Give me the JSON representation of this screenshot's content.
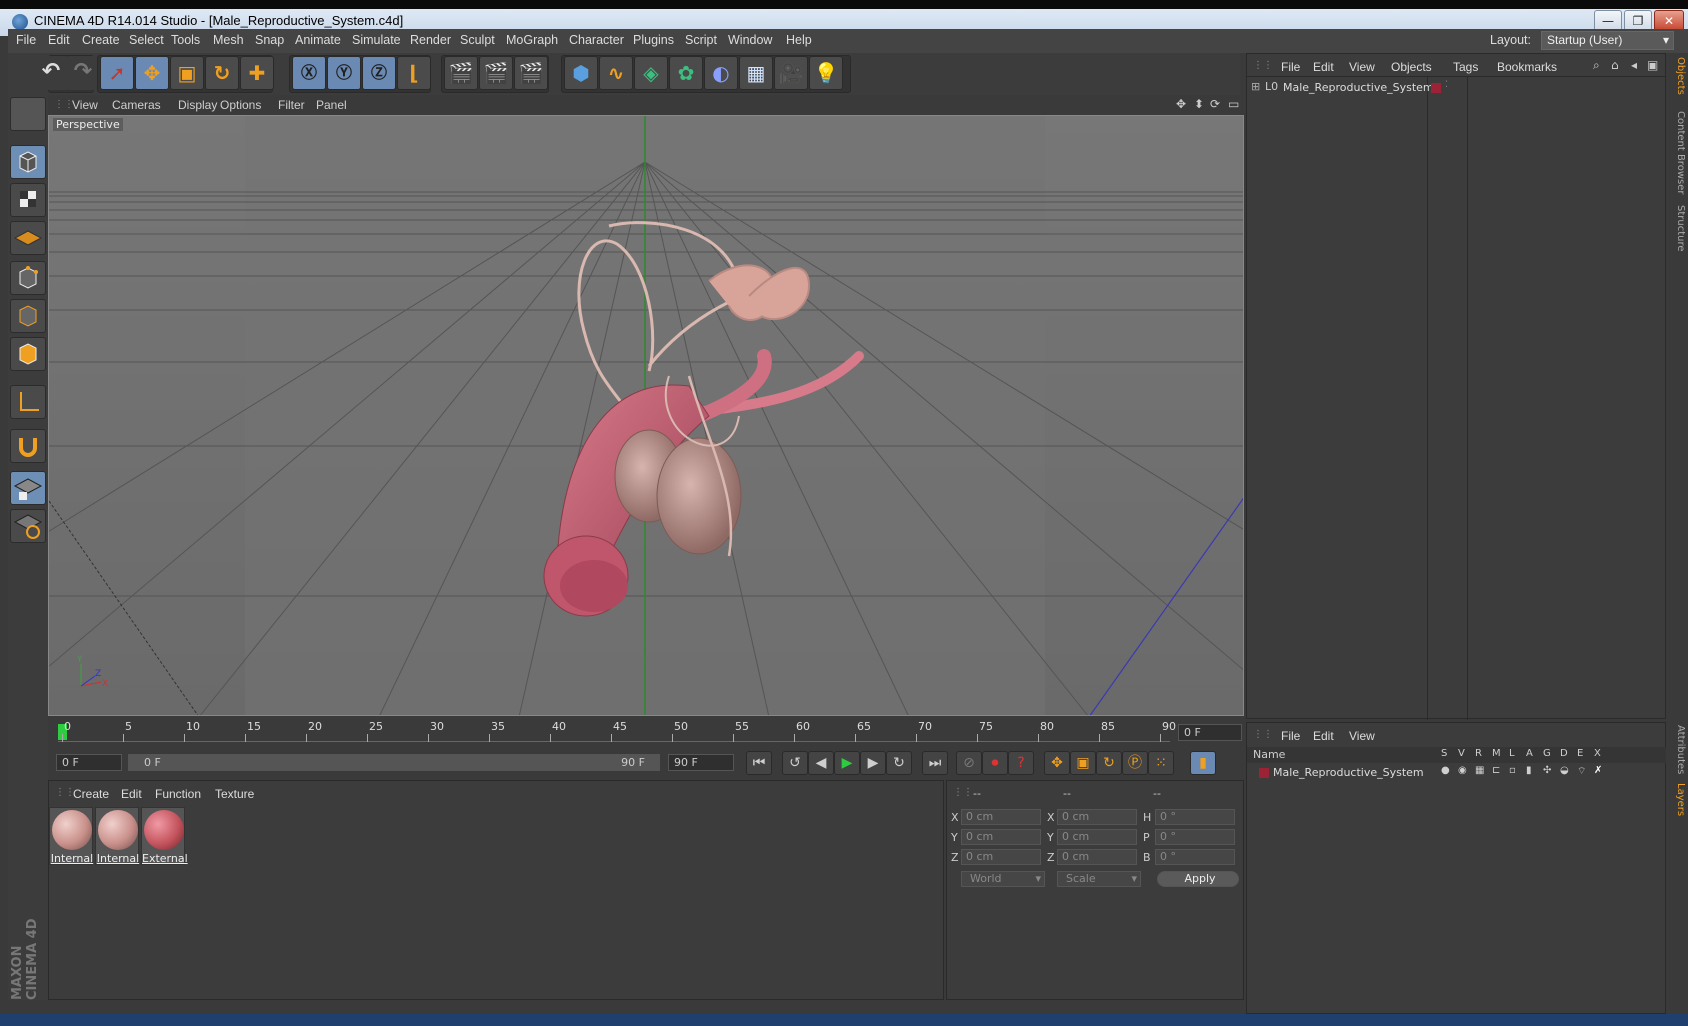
{
  "window": {
    "title": "CINEMA 4D R14.014 Studio - [Male_Reproductive_System.c4d]",
    "min": "—",
    "max": "❐",
    "close": "✕"
  },
  "menubar": {
    "items": [
      "File",
      "Edit",
      "Create",
      "Select",
      "Tools",
      "Mesh",
      "Snap",
      "Animate",
      "Simulate",
      "Render",
      "Sculpt",
      "MoGraph",
      "Character",
      "Plugins",
      "Script",
      "Window",
      "Help"
    ],
    "layout_label": "Layout:",
    "layout_value": "Startup (User)"
  },
  "viewport": {
    "menu": [
      "View",
      "Cameras",
      "Display",
      "Options",
      "Filter",
      "Panel"
    ],
    "label": "Perspective"
  },
  "timeline": {
    "ticks": [
      "0",
      "5",
      "10",
      "15",
      "20",
      "25",
      "30",
      "35",
      "40",
      "45",
      "50",
      "55",
      "60",
      "65",
      "70",
      "75",
      "80",
      "85",
      "90"
    ],
    "current_frame": "0 F",
    "start_field": "0 F",
    "range_start": "0 F",
    "range_end": "90 F",
    "end_field": "90 F"
  },
  "materials": {
    "menu": [
      "Create",
      "Edit",
      "Function",
      "Texture"
    ],
    "items": [
      {
        "name": "Internal",
        "color": "#c9908a"
      },
      {
        "name": "Internal",
        "color": "#c98f8a"
      },
      {
        "name": "External",
        "color": "#c4545e"
      }
    ]
  },
  "coordinates": {
    "headers": [
      "--",
      "--",
      "--"
    ],
    "rows": [
      {
        "axis": "X",
        "pos": "0 cm",
        "axis2": "X",
        "size": "0 cm",
        "rot_axis": "H",
        "rot": "0 °"
      },
      {
        "axis": "Y",
        "pos": "0 cm",
        "axis2": "Y",
        "size": "0 cm",
        "rot_axis": "P",
        "rot": "0 °"
      },
      {
        "axis": "Z",
        "pos": "0 cm",
        "axis2": "Z",
        "size": "0 cm",
        "rot_axis": "B",
        "rot": "0 °"
      }
    ],
    "mode": "World",
    "scale": "Scale",
    "apply": "Apply"
  },
  "objects": {
    "menu": [
      "File",
      "Edit",
      "View",
      "Objects",
      "Tags",
      "Bookmarks"
    ],
    "items": [
      {
        "name": "Male_Reproductive_System",
        "color": "#9b2335"
      }
    ]
  },
  "layers": {
    "menu": [
      "File",
      "Edit",
      "View"
    ],
    "name_header": "Name",
    "columns": [
      "S",
      "V",
      "R",
      "M",
      "L",
      "A",
      "G",
      "D",
      "E",
      "X"
    ],
    "items": [
      {
        "name": "Male_Reproductive_System",
        "color": "#9b2335"
      }
    ]
  },
  "side_tabs": [
    "Objects",
    "Content Browser",
    "Structure",
    "Attributes",
    "Layers"
  ],
  "logo": "MAXON CINEMA 4D"
}
